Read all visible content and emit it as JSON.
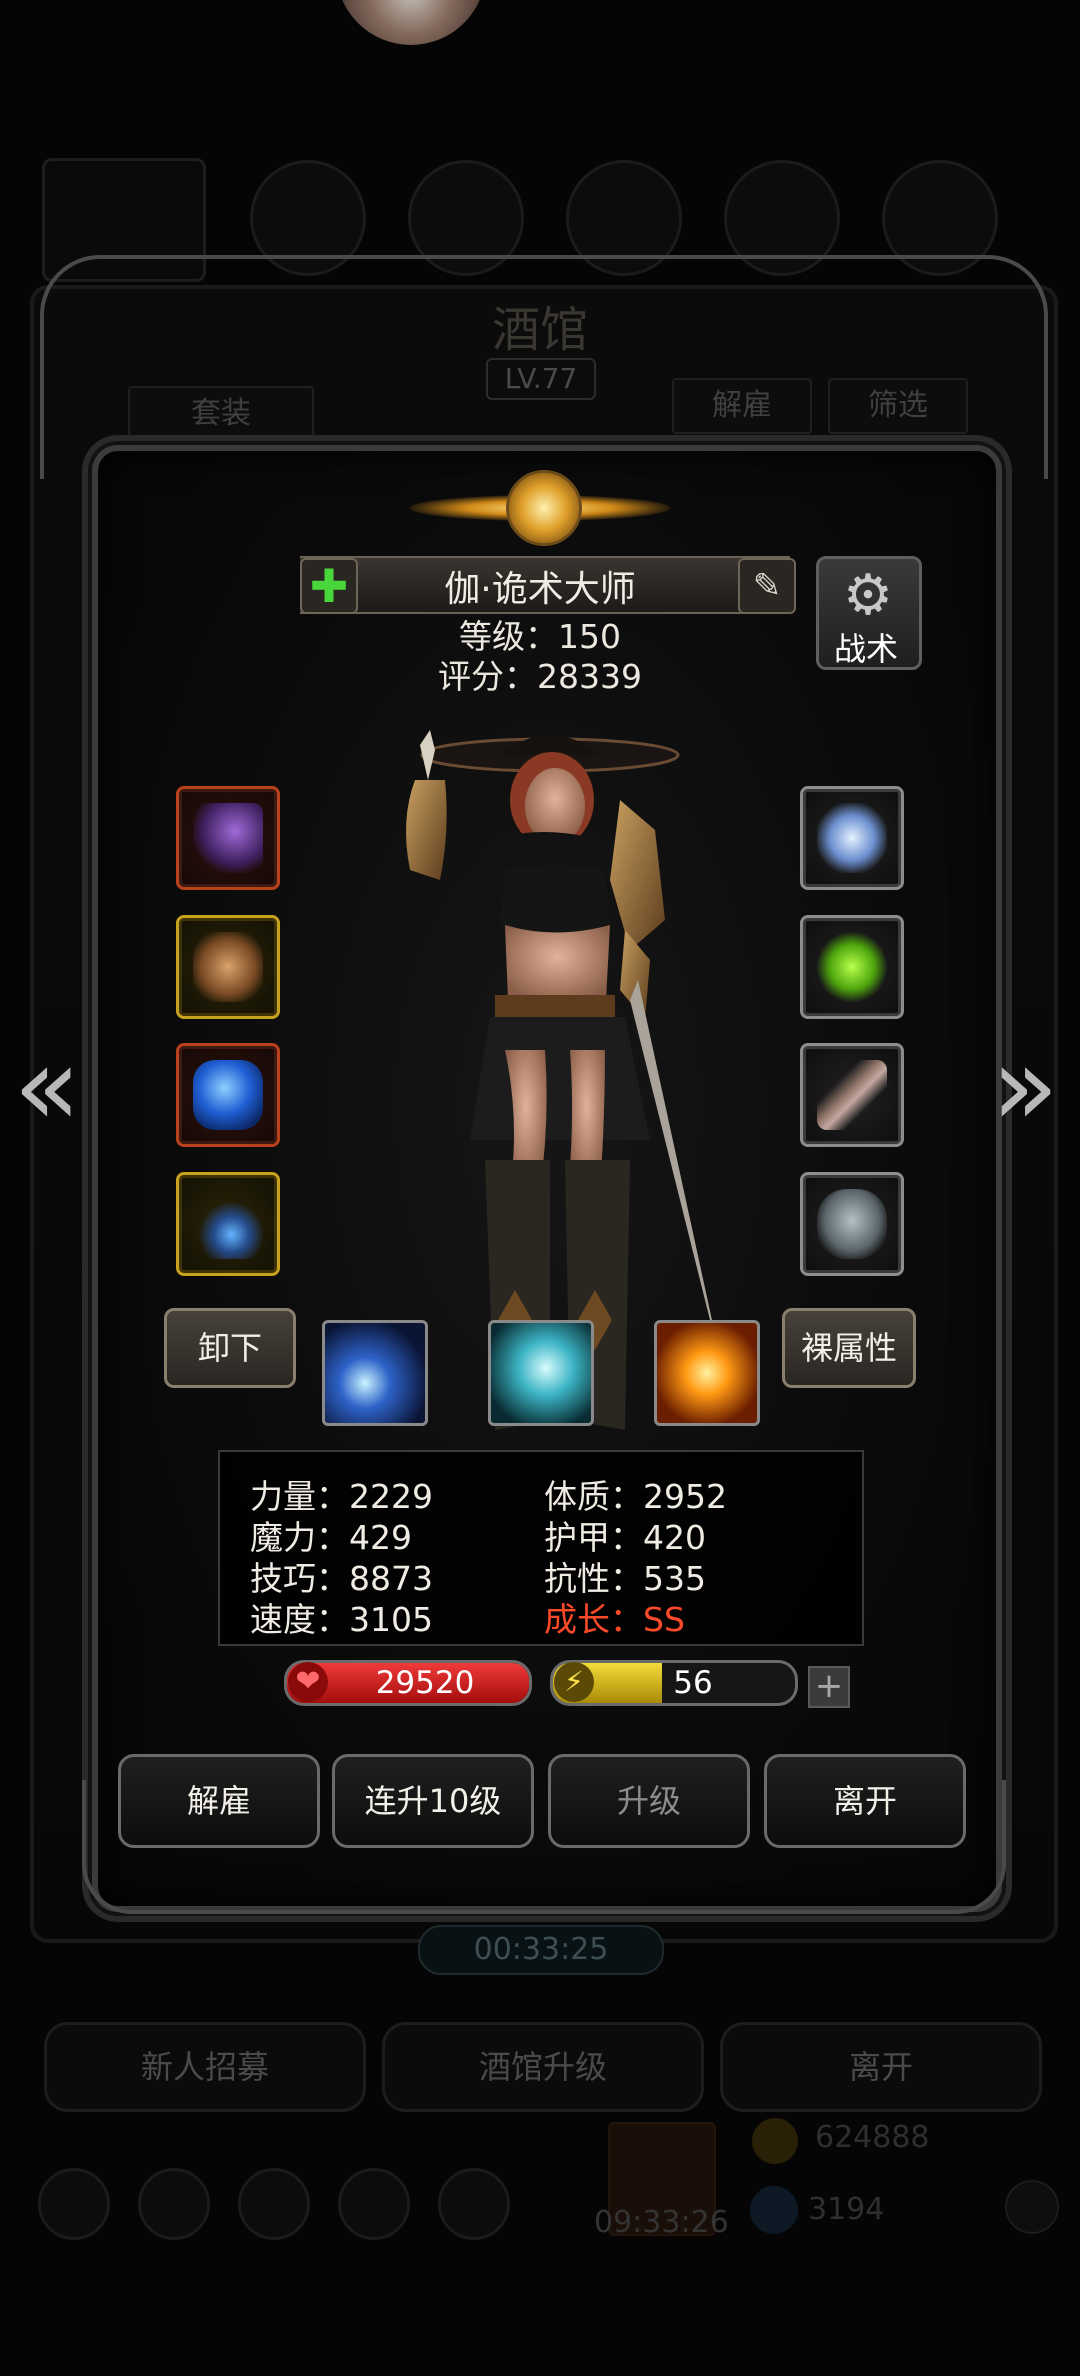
{
  "background": {
    "title": "酒馆",
    "level_badge": "LV.77",
    "btn_set": "套装",
    "btn_dismiss": "解雇",
    "btn_filter": "筛选",
    "timer": "00:33:25",
    "btn_recruit": "新人招募",
    "btn_upgrade_tavern": "酒馆升级",
    "btn_leave": "离开",
    "gift_timer": "09:33:26",
    "gold": "624888",
    "gems": "3194"
  },
  "hero": {
    "name": "伽·诡术大师",
    "level_text": "等级：150",
    "score_text": "评分：28339",
    "tactics_label": "战术"
  },
  "equipment": {
    "left": [
      {
        "icon": "dagger-icon",
        "rarity": "red"
      },
      {
        "icon": "armor-icon",
        "rarity": "gold"
      },
      {
        "icon": "blue-gem-icon",
        "rarity": "red"
      },
      {
        "icon": "amulet-icon",
        "rarity": "gold"
      }
    ],
    "right": [
      {
        "icon": "crown-icon",
        "rarity": "grey"
      },
      {
        "icon": "green-crystal-icon",
        "rarity": "grey"
      },
      {
        "icon": "feather-icon",
        "rarity": "grey"
      },
      {
        "icon": "mask-icon",
        "rarity": "grey"
      }
    ]
  },
  "actions_row": {
    "unequip": "卸下",
    "base_attrs": "裸属性",
    "skills": [
      "light-beam-skill-icon",
      "whirl-skill-icon",
      "fire-burst-skill-icon"
    ]
  },
  "stats": {
    "strength": "力量：2229",
    "constitution": "体质：2952",
    "magic": "魔力：429",
    "armor": "护甲：420",
    "skill": "技巧：8873",
    "resistance": "抗性：535",
    "speed": "速度：3105",
    "growth": "成长：SS"
  },
  "bars": {
    "hp": "29520",
    "energy": "56",
    "energy_fill": 0.45
  },
  "buttons": {
    "dismiss": "解雇",
    "upgrade10": "连升10级",
    "upgrade": "升级",
    "leave": "离开"
  },
  "colors": {
    "hp_red": "#d01818",
    "energy_yellow": "#e1c21a",
    "growth_red": "#ff4a2a",
    "plus_green": "#49d63a"
  }
}
